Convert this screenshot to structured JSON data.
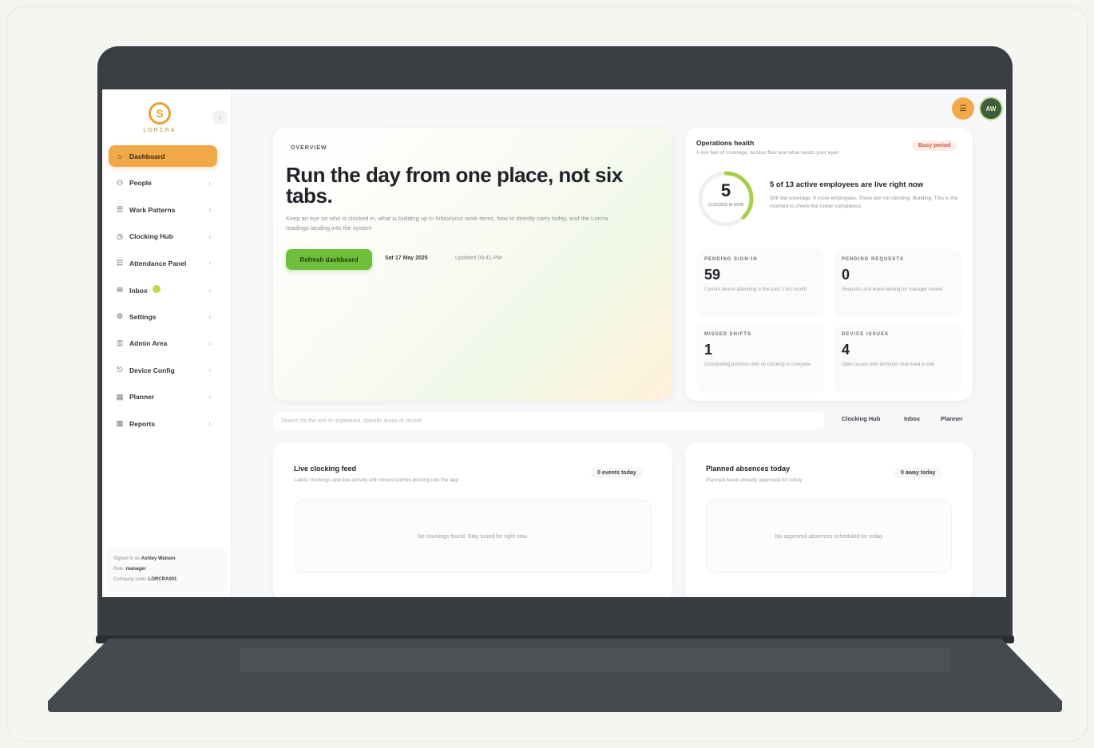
{
  "sidebar": {
    "brand": "LORCRA",
    "collapse_icon": "‹",
    "items": [
      {
        "label": "Dashboard",
        "icon": "⌂",
        "active": true
      },
      {
        "label": "People",
        "icon": "⚇"
      },
      {
        "label": "Work Patterns",
        "icon": "☰"
      },
      {
        "label": "Clocking Hub",
        "icon": "◷"
      },
      {
        "label": "Attendance Panel",
        "icon": "☷"
      },
      {
        "label": "Inbox",
        "icon": "✉",
        "badge": true
      },
      {
        "label": "Settings",
        "icon": "⚙"
      },
      {
        "label": "Admin Area",
        "icon": "⚿"
      },
      {
        "label": "Device Config",
        "icon": "⎋"
      },
      {
        "label": "Planner",
        "icon": "▤"
      },
      {
        "label": "Reports",
        "icon": "▥"
      }
    ],
    "user": {
      "signed_in_label": "Signed in as",
      "name": "Ashley Watson",
      "role_label": "Role:",
      "role": "manager",
      "company_label": "Company code:",
      "company": "LORCRA001"
    }
  },
  "topbar": {
    "menu_icon": "☰",
    "avatar_initials": "AW"
  },
  "hero": {
    "tag": "OVERVIEW",
    "title": "Run the day from one place, not six tabs.",
    "description": "Keep an eye on who is clocked in, what is building up in Inbox/your work items, how to directly carry today, and the Lorcra readings landing into the system",
    "refresh_label": "Refresh dashboard",
    "date": "Sat 17 May 2025",
    "updated": "Updated 09:41 PM"
  },
  "ops": {
    "title": "Operations health",
    "subtitle": "A live feel of coverage, access flow and what needs your eyes",
    "badge": "Busy period",
    "ring_value": "5",
    "ring_caption": "CLOCKED IN NOW",
    "headline": "5 of 13 active employees are live right now",
    "description": "Still low coverage. 8 more employees. There are not clocking. Building. This is the moment to check live roster compliance.",
    "ring_fraction": 0.38,
    "stats": [
      {
        "label": "PENDING SIGN-IN",
        "value": "59",
        "desc": "Current device attending in the past 2 hrs month"
      },
      {
        "label": "PENDING REQUESTS",
        "value": "0",
        "desc": "Requests and leave waiting for manager review"
      },
      {
        "label": "MISSED SHIFTS",
        "value": "1",
        "desc": "Outstanding punches with no clocking to complete"
      },
      {
        "label": "DEVICE ISSUES",
        "value": "4",
        "desc": "Open issues with terminals that need a look"
      }
    ]
  },
  "search": {
    "placeholder": "Search for the tool to implement, specific areas or record",
    "quick_links": [
      "Clocking Hub",
      "Inbox",
      "Planner"
    ]
  },
  "panels": [
    {
      "title": "Live clocking feed",
      "subtitle": "Latest clockings and live activity with recent entries pouring into the app",
      "badge": "0 events today",
      "empty": "No clockings found. Stay tuned for right now."
    },
    {
      "title": "Planned absences today",
      "subtitle": "Planned leave already approved for today",
      "badge": "0 away today",
      "empty": "No approved absences scheduled for today"
    }
  ],
  "colors": {
    "accent": "#f0a848",
    "primary_green": "#6fbf3c",
    "danger": "#d0523a"
  }
}
